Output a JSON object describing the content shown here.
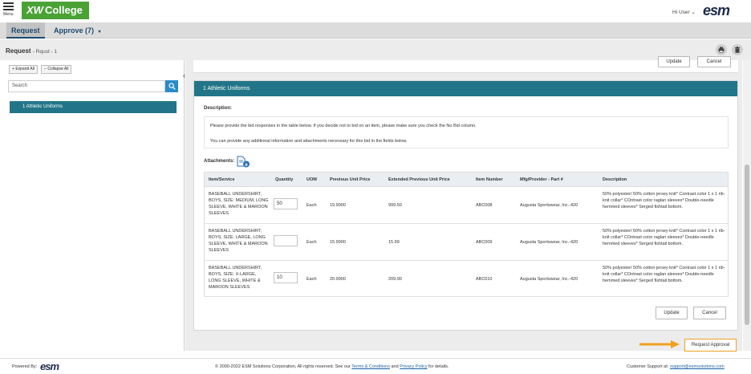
{
  "header": {
    "menu_label": "Menu",
    "logo_text": "College",
    "user_greeting": "Hi User",
    "brand": "esm"
  },
  "nav": {
    "request_tab": "Request",
    "approve_tab": "Approve (7)"
  },
  "page": {
    "title": "Request",
    "subtitle": "- Rqust - 1"
  },
  "sidebar": {
    "expand_all": "Expand All",
    "collapse_all": "Collapse All",
    "search_placeholder": "Search",
    "items": [
      {
        "label": "1 Athletic Uniforms"
      }
    ]
  },
  "top_actions": {
    "update": "Update",
    "cancel": "Cancel"
  },
  "section": {
    "title": "1 Athletic Uniforms",
    "description_label": "Description:",
    "description_lines": [
      "Please provide the bid responses in the table below. If you decide not to bid on an item, please make sure you check the No Bid column.",
      "You can provide any additional information and attachments necessary for this bid in the fields below."
    ],
    "attachments_label": "Attachments:"
  },
  "table": {
    "columns": [
      "Item/Service",
      "Quantity",
      "UOM",
      "Previous Unit Price",
      "Extended Previous Unit Price",
      "Item Number",
      "Mfg/Provider - Part #",
      "Description"
    ],
    "rows": [
      {
        "item": "BASEBALL UNDERSHIRT, BOYS, SIZE: MEDIUM, LONG SLEEVE, WHITE & MAROON SLEEVES",
        "quantity": "50",
        "uom": "Each",
        "prev_price": "19.9900",
        "ext_price": "999.50",
        "item_number": "ABC008",
        "mfg": "Augusta Sportswear, Inc.-420",
        "description": "50% polyester/ 50% cotton jersey knit* Contrast color 1 x 1 rib-knit collar* COntrast color raglan sleeves* Double-needle hemmed sleeves* Serged fishtail bottom."
      },
      {
        "item": "BASEBALL UNDERSHIRT, BOYS, SIZE: LARGE, LONG SLEEVE, WHITE & MAROON SLEEVES",
        "quantity": "",
        "uom": "Each",
        "prev_price": "15.9900",
        "ext_price": "15.99",
        "item_number": "ABC009",
        "mfg": "Augusta Sportswear, Inc.-420",
        "description": "50% polyester/ 50% cotton jersey knit* Contrast color 1 x 1 rib-knit collar* COntrast color raglan sleeves* Double-needle hemmed sleeves* Serged fishtail bottom."
      },
      {
        "item": "BASEBALL UNDERSHIRT, BOYS, SIZE: X-LARGE, LONG SLEEVE, WHITE & MAROON SLEEVES",
        "quantity": "10",
        "uom": "Each",
        "prev_price": "20.9900",
        "ext_price": "209.90",
        "item_number": "ABC010",
        "mfg": "Augusta Sportswear, Inc.-420",
        "description": "50% polyester/ 50% cotton jersey knit* Contrast color 1 x 1 rib-knit collar* COntrast color raglan sleeves* Double-needle hemmed sleeves* Serged fishtail bottom."
      }
    ]
  },
  "bottom_actions": {
    "update": "Update",
    "cancel": "Cancel",
    "request_approval": "Request Approval"
  },
  "footer": {
    "powered_by": "Powered By:",
    "brand": "esm",
    "copyright_pre": "© 2000-2022 ESM Solutions Corporation, All rights reserved. See our",
    "terms_link": "Terms & Conditions",
    "and": "and",
    "privacy_link": "Privacy Policy",
    "copyright_post": "for details.",
    "support_text": "Customer Support at:",
    "support_email": "support@esmsolutions.com"
  },
  "colors": {
    "teal": "#227588",
    "green": "#4aa235",
    "accent_orange": "#f0a020",
    "link_blue": "#1c62a8"
  },
  "icons": [
    "menu-icon",
    "chevron-down-icon",
    "print-icon",
    "trash-icon",
    "search-icon",
    "collapse-left-icon",
    "attachment-icon",
    "arrow-right-icon"
  ]
}
